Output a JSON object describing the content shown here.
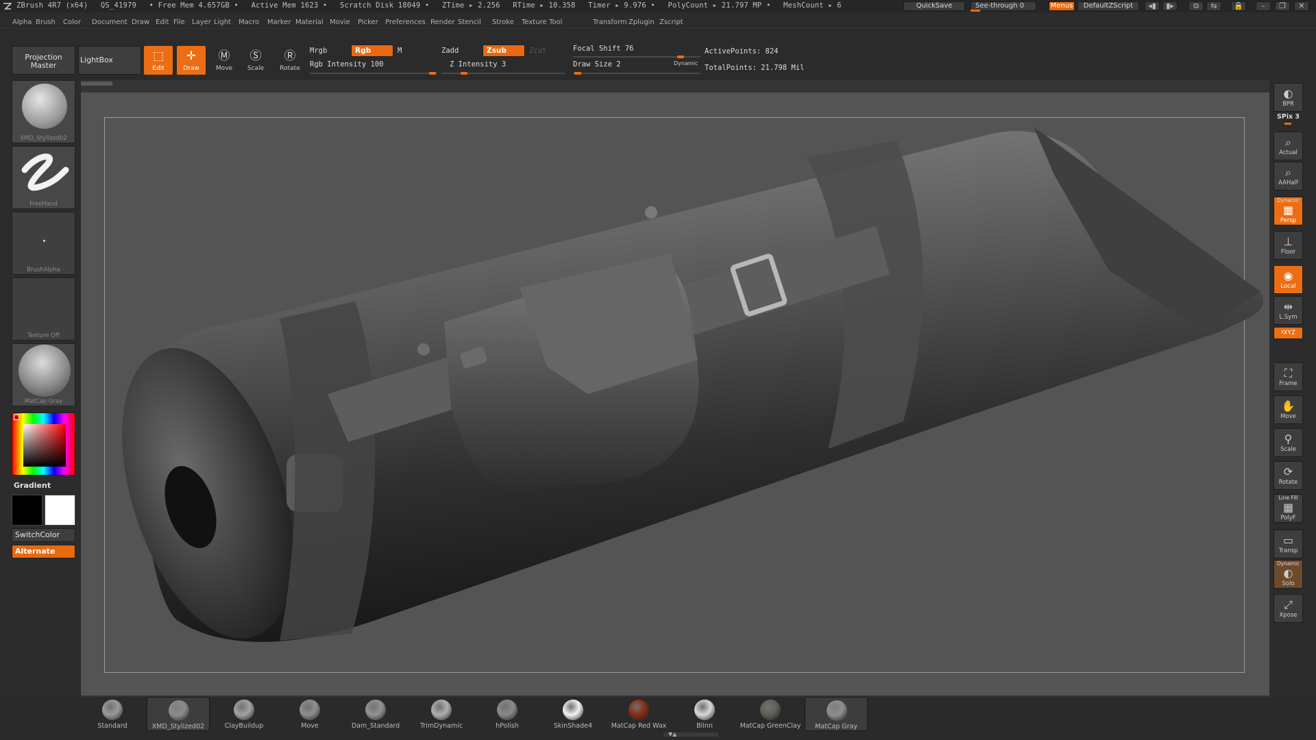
{
  "titlebar": {
    "app": "ZBrush 4R7 (x64)",
    "session": "QS_41979",
    "free_mem": "• Free Mem 4.657GB •",
    "active_mem": "Active Mem 1623 •",
    "scratch_disk": "Scratch Disk 18049 •",
    "ztime": "ZTime ▸ 2.256",
    "rtime": "RTime ▸ 10.358",
    "timer": "Timer ▸ 9.976 •",
    "polycount": "PolyCount ▸ 21.797 MP •",
    "meshcount": "MeshCount ▸ 6",
    "quicksave": "QuickSave",
    "see_through": "See-through  0",
    "menus": "Menus",
    "defaultzscript": "DefaultZScript"
  },
  "menubar": [
    "Alpha",
    "Brush",
    "Color",
    "Document",
    "Draw",
    "Edit",
    "File",
    "Layer",
    "Light",
    "Macro",
    "Marker",
    "Material",
    "Movie",
    "Picker",
    "Preferences",
    "Render",
    "Stencil",
    "Stroke",
    "Texture",
    "Tool",
    "Transform",
    "Zplugin",
    "Zscript"
  ],
  "shelf": {
    "projection_master": "Projection Master",
    "lightbox": "LightBox",
    "edit": "Edit",
    "draw": "Draw",
    "move": "Move",
    "scale": "Scale",
    "rotate": "Rotate",
    "mrgb": "Mrgb",
    "rgb": "Rgb",
    "m": "M",
    "rgb_intensity": "Rgb  Intensity 100",
    "zadd": "Zadd",
    "zsub": "Zsub",
    "zcut": "Zcut",
    "z_intensity": "Z  Intensity 3",
    "focal_shift": "Focal  Shift 76",
    "draw_size": "Draw  Size 2",
    "dynamic": "Dynamic",
    "active_points": "ActivePoints: 824",
    "total_points": "TotalPoints: 21.798  Mil"
  },
  "lefttray": {
    "brush_name": "XMD_Stylized02",
    "stroke_name": "FreeHand",
    "alpha_name": "BrushAlpha",
    "texture_name": "Texture  Off",
    "material_name": "MatCap  Gray",
    "gradient": "Gradient",
    "switchcolor": "SwitchColor",
    "alternate": "Alternate"
  },
  "righttray": [
    {
      "name": "bpr-button",
      "label": "BPR"
    },
    {
      "name": "spix-label",
      "label": "SPix 3"
    },
    {
      "name": "actual-button",
      "label": "Actual"
    },
    {
      "name": "aahalf-button",
      "label": "AAHalf"
    },
    {
      "name": "persp-button",
      "label": "Persp",
      "top": "Dynamic"
    },
    {
      "name": "floor-button",
      "label": "Floor"
    },
    {
      "name": "local-button",
      "label": "Local"
    },
    {
      "name": "lsym-button",
      "label": "L.Sym"
    },
    {
      "name": "xyz-button",
      "label": "ᵡXYZ"
    },
    {
      "name": "frame-button",
      "label": "Frame"
    },
    {
      "name": "move-view-button",
      "label": "Move"
    },
    {
      "name": "scale-view-button",
      "label": "Scale"
    },
    {
      "name": "rotate-view-button",
      "label": "Rotate"
    },
    {
      "name": "polyf-button",
      "label": "PolyF",
      "top": "Line Fill"
    },
    {
      "name": "transp-button",
      "label": "Transp"
    },
    {
      "name": "solo-button",
      "label": "Solo",
      "top": "Dynamic"
    },
    {
      "name": "xpose-button",
      "label": "Xpose"
    }
  ],
  "materials": [
    {
      "label": "Standard",
      "color": "#9a9a9a"
    },
    {
      "label": "XMD_Stylized02",
      "color": "#8c8c8c",
      "selected": true
    },
    {
      "label": "ClayBuildup",
      "color": "#a2a2a2"
    },
    {
      "label": "Move",
      "color": "#8f8f8f"
    },
    {
      "label": "Dam_Standard",
      "color": "#939393"
    },
    {
      "label": "TrimDynamic",
      "color": "#b0b0b0"
    },
    {
      "label": "hPolish",
      "color": "#8a8a8a"
    },
    {
      "label": "SkinShade4",
      "color": "#f2f2f2"
    },
    {
      "label": "MatCap  Red  Wax",
      "color": "#8b2a1a"
    },
    {
      "label": "Blinn",
      "color": "#d8d8d8"
    },
    {
      "label": "MatCap  GreenClay",
      "color": "#5f6056"
    },
    {
      "label": "MatCap  Gray",
      "color": "#8e8e8e",
      "selected": true
    }
  ],
  "colors": {
    "accent": "#ec6d13",
    "bg": "#2b2b2b",
    "canvas": "#545454"
  }
}
